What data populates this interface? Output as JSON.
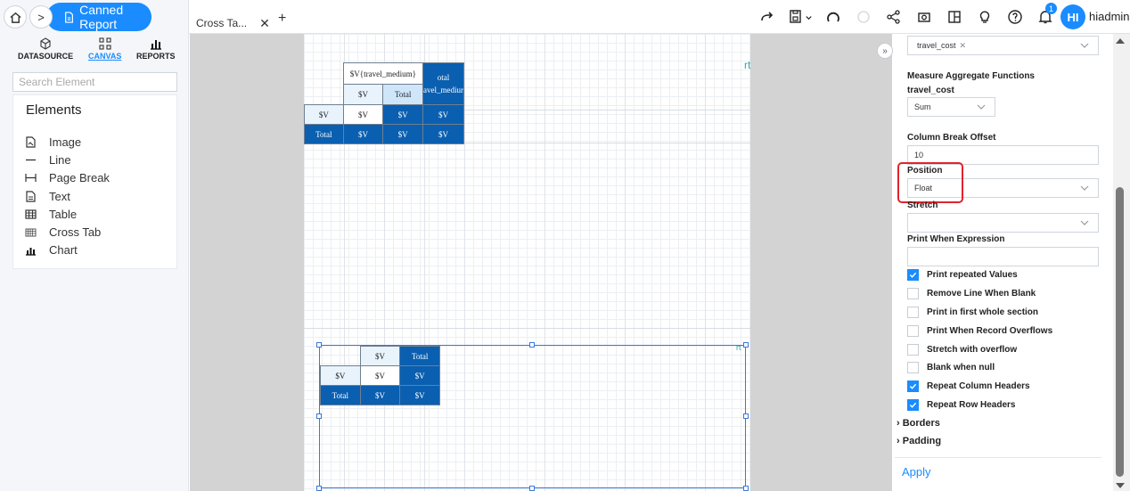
{
  "header": {
    "report_name": "Canned Report",
    "tab_name": "Cross Ta...",
    "tab_close": "✕",
    "tab_add": "+",
    "breadcrumb_sep": ">",
    "notification_count": "1",
    "avatar_initials": "HI",
    "username": "hiadmin"
  },
  "sidebar": {
    "tabs": [
      {
        "label": "DATASOURCE",
        "icon": "cube-icon"
      },
      {
        "label": "CANVAS",
        "icon": "canvas-icon",
        "active": true
      },
      {
        "label": "REPORTS",
        "icon": "bar-chart-icon"
      }
    ],
    "search_placeholder": "Search Element",
    "elements_title": "Elements",
    "elements": [
      {
        "label": "Image",
        "icon": "image-icon"
      },
      {
        "label": "Line",
        "icon": "line-icon"
      },
      {
        "label": "Page Break",
        "icon": "page-break-icon"
      },
      {
        "label": "Text",
        "icon": "text-icon"
      },
      {
        "label": "Table",
        "icon": "table-icon"
      },
      {
        "label": "Cross Tab",
        "icon": "cross-tab-icon"
      },
      {
        "label": "Chart",
        "icon": "chart-icon"
      }
    ]
  },
  "canvas": {
    "corner_text": "rt",
    "crosstab1": {
      "col_header": "$V{travel_medium}",
      "total_col": "otal",
      "total_col_sub": "avel_mediur",
      "v": "$V",
      "total": "Total"
    },
    "crosstab2": {
      "v": "$V",
      "total": "Total"
    }
  },
  "properties": {
    "measure_chip": "travel_cost",
    "measure_agg_label": "Measure Aggregate Functions",
    "measure_field": "travel_cost",
    "agg_value": "Sum",
    "col_break_label": "Column Break Offset",
    "col_break_value": "10",
    "position_label": "Position",
    "position_value": "Float",
    "stretch_label": "Stretch",
    "stretch_value": "",
    "print_when_label": "Print When Expression",
    "print_when_value": "",
    "checkboxes": [
      {
        "label": "Print repeated Values",
        "checked": true
      },
      {
        "label": "Remove Line When Blank",
        "checked": false
      },
      {
        "label": "Print in first whole section",
        "checked": false
      },
      {
        "label": "Print When Record Overflows",
        "checked": false
      },
      {
        "label": "Stretch with overflow",
        "checked": false
      },
      {
        "label": "Blank when null",
        "checked": false
      },
      {
        "label": "Repeat Column Headers",
        "checked": true
      },
      {
        "label": "Repeat Row Headers",
        "checked": true
      }
    ],
    "sections": [
      "Borders",
      "Padding"
    ],
    "apply_label": "Apply"
  },
  "colors": {
    "accent": "#1a8cff",
    "crosstab_dark": "#0a5fb0",
    "highlight": "#e0242e"
  }
}
